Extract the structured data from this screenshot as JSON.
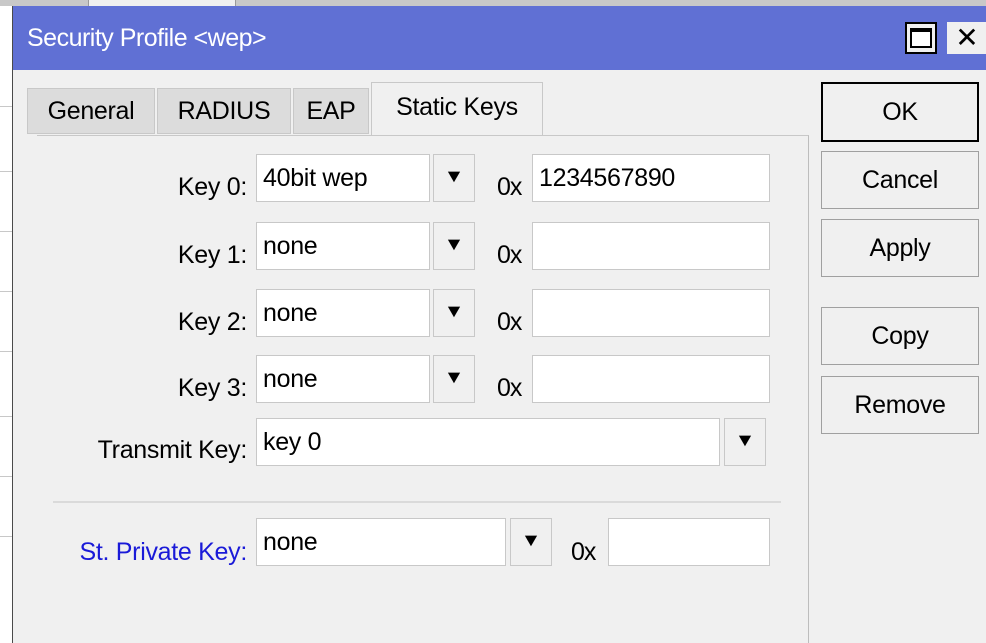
{
  "window": {
    "title": "Security Profile <wep>",
    "maximize_icon": "maximize-icon",
    "close_icon": "close-icon",
    "close_glyph": "✕"
  },
  "tabs": [
    {
      "label": "General",
      "active": false
    },
    {
      "label": "RADIUS",
      "active": false
    },
    {
      "label": "EAP",
      "active": false
    },
    {
      "label": "Static Keys",
      "active": true
    }
  ],
  "keys": [
    {
      "label": "Key 0:",
      "type": "40bit wep",
      "prefix": "0x",
      "value": "1234567890"
    },
    {
      "label": "Key 1:",
      "type": "none",
      "prefix": "0x",
      "value": ""
    },
    {
      "label": "Key 2:",
      "type": "none",
      "prefix": "0x",
      "value": ""
    },
    {
      "label": "Key 3:",
      "type": "none",
      "prefix": "0x",
      "value": ""
    }
  ],
  "transmit_key": {
    "label": "Transmit Key:",
    "value": "key 0"
  },
  "private_key": {
    "label": "St. Private Key:",
    "type": "none",
    "prefix": "0x",
    "value": ""
  },
  "dropdown_glyph": "⯆",
  "buttons": {
    "ok": "OK",
    "cancel": "Cancel",
    "apply": "Apply",
    "copy": "Copy",
    "remove": "Remove"
  },
  "colors": {
    "titlebar": "#6070d4",
    "private_key_label": "#1a1ad8"
  }
}
